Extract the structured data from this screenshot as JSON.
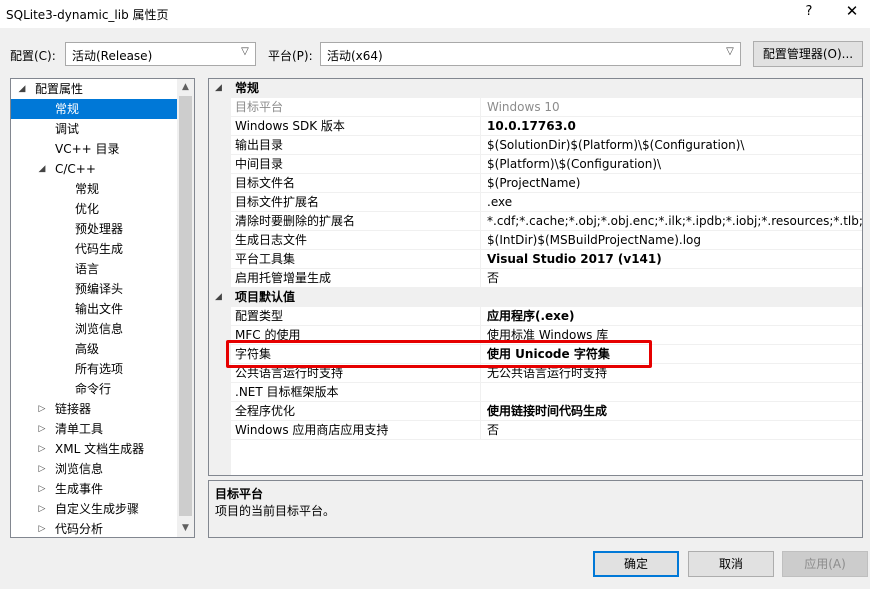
{
  "window": {
    "title": "SQLite3-dynamic_lib 属性页",
    "help": "?",
    "close": "✕"
  },
  "toolbar": {
    "config_label": "配置(C):",
    "config_value": "活动(Release)",
    "platform_label": "平台(P):",
    "platform_value": "活动(x64)",
    "config_manager_button": "配置管理器(O)..."
  },
  "tree": {
    "items": [
      {
        "label": "配置属性",
        "toggle": "◢",
        "level": 0,
        "selected": false
      },
      {
        "label": "常规",
        "toggle": "",
        "level": 1,
        "selected": true
      },
      {
        "label": "调试",
        "toggle": "",
        "level": 1,
        "selected": false
      },
      {
        "label": "VC++ 目录",
        "toggle": "",
        "level": 1,
        "selected": false
      },
      {
        "label": "C/C++",
        "toggle": "◢",
        "level": 1,
        "selected": false
      },
      {
        "label": "常规",
        "toggle": "",
        "level": 2,
        "selected": false
      },
      {
        "label": "优化",
        "toggle": "",
        "level": 2,
        "selected": false
      },
      {
        "label": "预处理器",
        "toggle": "",
        "level": 2,
        "selected": false
      },
      {
        "label": "代码生成",
        "toggle": "",
        "level": 2,
        "selected": false
      },
      {
        "label": "语言",
        "toggle": "",
        "level": 2,
        "selected": false
      },
      {
        "label": "预编译头",
        "toggle": "",
        "level": 2,
        "selected": false
      },
      {
        "label": "输出文件",
        "toggle": "",
        "level": 2,
        "selected": false
      },
      {
        "label": "浏览信息",
        "toggle": "",
        "level": 2,
        "selected": false
      },
      {
        "label": "高级",
        "toggle": "",
        "level": 2,
        "selected": false
      },
      {
        "label": "所有选项",
        "toggle": "",
        "level": 2,
        "selected": false
      },
      {
        "label": "命令行",
        "toggle": "",
        "level": 2,
        "selected": false
      },
      {
        "label": "链接器",
        "toggle": "▷",
        "level": 1,
        "selected": false
      },
      {
        "label": "清单工具",
        "toggle": "▷",
        "level": 1,
        "selected": false
      },
      {
        "label": "XML 文档生成器",
        "toggle": "▷",
        "level": 1,
        "selected": false
      },
      {
        "label": "浏览信息",
        "toggle": "▷",
        "level": 1,
        "selected": false
      },
      {
        "label": "生成事件",
        "toggle": "▷",
        "level": 1,
        "selected": false
      },
      {
        "label": "自定义生成步骤",
        "toggle": "▷",
        "level": 1,
        "selected": false
      },
      {
        "label": "代码分析",
        "toggle": "▷",
        "level": 1,
        "selected": false
      }
    ]
  },
  "grid": {
    "categories": [
      {
        "name": "常规",
        "toggle": "◢",
        "rows": [
          {
            "name": "目标平台",
            "value": "Windows 10",
            "disabled": true,
            "bold": false
          },
          {
            "name": "Windows SDK 版本",
            "value": "10.0.17763.0",
            "disabled": false,
            "bold": true
          },
          {
            "name": "输出目录",
            "value": "$(SolutionDir)$(Platform)\\$(Configuration)\\",
            "disabled": false,
            "bold": false
          },
          {
            "name": "中间目录",
            "value": "$(Platform)\\$(Configuration)\\",
            "disabled": false,
            "bold": false
          },
          {
            "name": "目标文件名",
            "value": "$(ProjectName)",
            "disabled": false,
            "bold": false
          },
          {
            "name": "目标文件扩展名",
            "value": ".exe",
            "disabled": false,
            "bold": false
          },
          {
            "name": "清除时要删除的扩展名",
            "value": "*.cdf;*.cache;*.obj;*.obj.enc;*.ilk;*.ipdb;*.iobj;*.resources;*.tlb;*.tli;*.t",
            "disabled": false,
            "bold": false
          },
          {
            "name": "生成日志文件",
            "value": "$(IntDir)$(MSBuildProjectName).log",
            "disabled": false,
            "bold": false
          },
          {
            "name": "平台工具集",
            "value": "Visual Studio 2017 (v141)",
            "disabled": false,
            "bold": true
          },
          {
            "name": "启用托管增量生成",
            "value": "否",
            "disabled": false,
            "bold": false
          }
        ]
      },
      {
        "name": "项目默认值",
        "toggle": "◢",
        "rows": [
          {
            "name": "配置类型",
            "value": "应用程序(.exe)",
            "disabled": false,
            "bold": true
          },
          {
            "name": "MFC 的使用",
            "value": "使用标准 Windows 库",
            "disabled": false,
            "bold": false
          },
          {
            "name": "字符集",
            "value": "使用 Unicode 字符集",
            "disabled": false,
            "bold": true
          },
          {
            "name": "公共语言运行时支持",
            "value": "无公共语言运行时支持",
            "disabled": false,
            "bold": false
          },
          {
            "name": ".NET 目标框架版本",
            "value": "",
            "disabled": false,
            "bold": false
          },
          {
            "name": "全程序优化",
            "value": "使用链接时间代码生成",
            "disabled": false,
            "bold": true
          },
          {
            "name": "Windows 应用商店应用支持",
            "value": "否",
            "disabled": false,
            "bold": false
          }
        ]
      }
    ]
  },
  "description": {
    "title": "目标平台",
    "text": "项目的当前目标平台。"
  },
  "buttons": {
    "ok": "确定",
    "cancel": "取消",
    "apply": "应用(A)"
  },
  "colors": {
    "selection": "#0078d7",
    "highlight_box": "#e60000",
    "disabled_text": "#8c8c8c"
  }
}
